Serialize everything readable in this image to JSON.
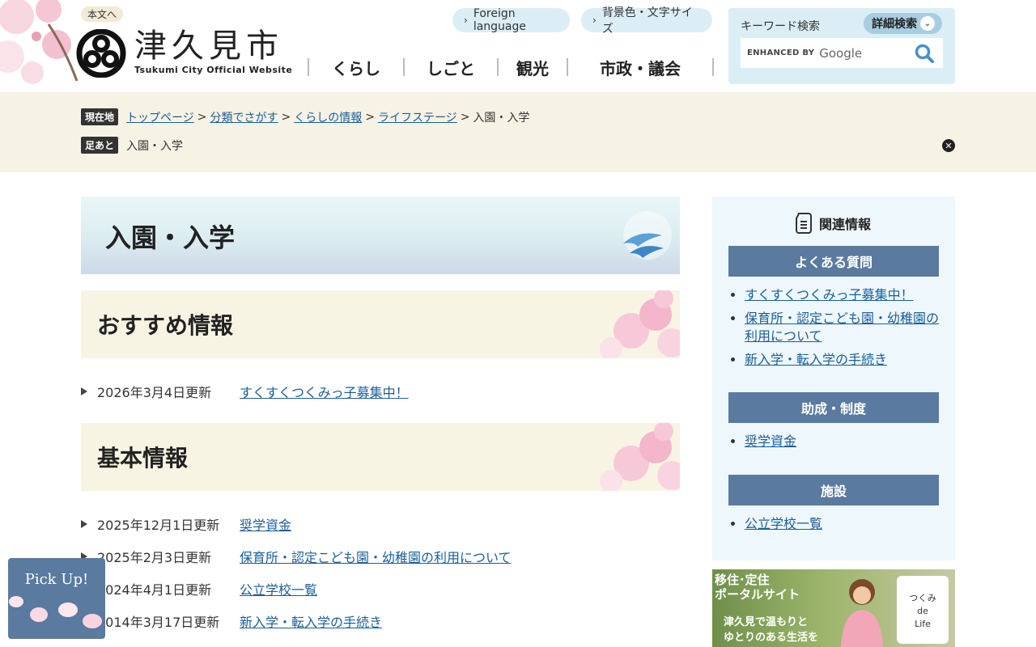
{
  "header": {
    "skip_link": "本文へ",
    "logo_jp": "津久見市",
    "logo_en": "Tsukumi City Official Website",
    "foreign_language": "Foreign language",
    "bg_text_size": "背景色・文字サイズ",
    "nav": [
      "くらし",
      "しごと",
      "観光",
      "市政・議会"
    ],
    "search": {
      "label": "キーワード検索",
      "detail_button": "詳細検索",
      "enhanced_by": "ENHANCED BY",
      "google": "Google"
    }
  },
  "breadcrumb": {
    "current_tag": "現在地",
    "trail": [
      "トップページ",
      "分類でさがす",
      "くらしの情報",
      "ライフステージ"
    ],
    "current": "入園・入学",
    "separator": ">",
    "footprint_tag": "足あと",
    "footprint": "入園・入学"
  },
  "main": {
    "title": "入園・入学",
    "sections": [
      {
        "heading": "おすすめ情報",
        "items": [
          {
            "date": "2026年3月4日更新",
            "link": "すくすくつくみっ子募集中！"
          }
        ]
      },
      {
        "heading": "基本情報",
        "items": [
          {
            "date": "2025年12月1日更新",
            "link": "奨学資金"
          },
          {
            "date": "2025年2月3日更新",
            "link": "保育所・認定こども園・幼稚園の利用について"
          },
          {
            "date": "2024年4月1日更新",
            "link": "公立学校一覧"
          },
          {
            "date": "2014年3月17日更新",
            "link": "新入学・転入学の手続き"
          }
        ]
      }
    ]
  },
  "sidebar": {
    "title": "関連情報",
    "groups": [
      {
        "heading": "よくある質問",
        "links": [
          "すくすくつくみっ子募集中！",
          "保育所・認定こども園・幼稚園の利用について",
          "新入学・転入学の手続き"
        ]
      },
      {
        "heading": "助成・制度",
        "links": [
          "奨学資金"
        ]
      },
      {
        "heading": "施設",
        "links": [
          "公立学校一覧"
        ]
      }
    ],
    "banner": {
      "line1": "移住･定住",
      "line2": "ポータルサイト",
      "line3": "津久見で温もりと",
      "line4": "ゆとりのある生活を",
      "logo_line1": "つくみ",
      "logo_line2": "de",
      "logo_line3": "Life"
    }
  },
  "pickup": {
    "label": "Pick Up!"
  },
  "colors": {
    "accent_blue": "#5a7aa0",
    "link": "#1a5e9a",
    "band": "#f6f2e4",
    "pill": "#dbeef6"
  }
}
